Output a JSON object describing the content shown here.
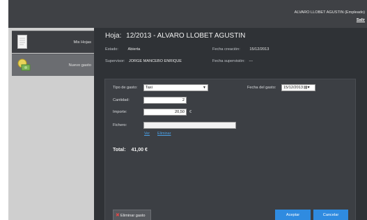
{
  "header": {
    "user": "ALVARO LLOBET AGUSTIN (Empleado)",
    "logout": "Salir"
  },
  "sidebar": {
    "items": [
      {
        "label": "Mis Hojas",
        "icon": "document-icon"
      },
      {
        "label": "Nuevo gasto",
        "icon": "money-icon"
      }
    ]
  },
  "main": {
    "title_label": "Hoja:",
    "title_value": "12/2013 - ALVARO LLOBET AGUSTIN",
    "estado_label": "Estado:",
    "estado_value": "Abierta",
    "creacion_label": "Fecha creación:",
    "creacion_value": "15/12/2013",
    "supervisor_label": "Supervisor:",
    "supervisor_value": "JORGE MANCEBO ENRIQUE",
    "supervision_label": "Fecha supervisión:",
    "supervision_value": "---"
  },
  "form": {
    "tipo_label": "Tipo de gasto:",
    "tipo_value": "Taxi",
    "fecha_label": "Fecha del gasto:",
    "fecha_value": "15/12/2013",
    "cantidad_label": "Cantidad:",
    "cantidad_value": "2",
    "importe_label": "Importe:",
    "importe_value": "20,50",
    "currency": "€",
    "fichero_label": "Fichero:",
    "fichero_value": "",
    "ver_link": "Ver",
    "eliminar_link": "Eliminar",
    "total_label": "Total:",
    "total_value": "41,00 €",
    "delete_button": "Eliminar gasto",
    "accept_button": "Aceptar",
    "cancel_button": "Cancelar"
  },
  "colors": {
    "header": "#3f4145",
    "main": "#2f3236",
    "accent": "#2f8be0"
  }
}
